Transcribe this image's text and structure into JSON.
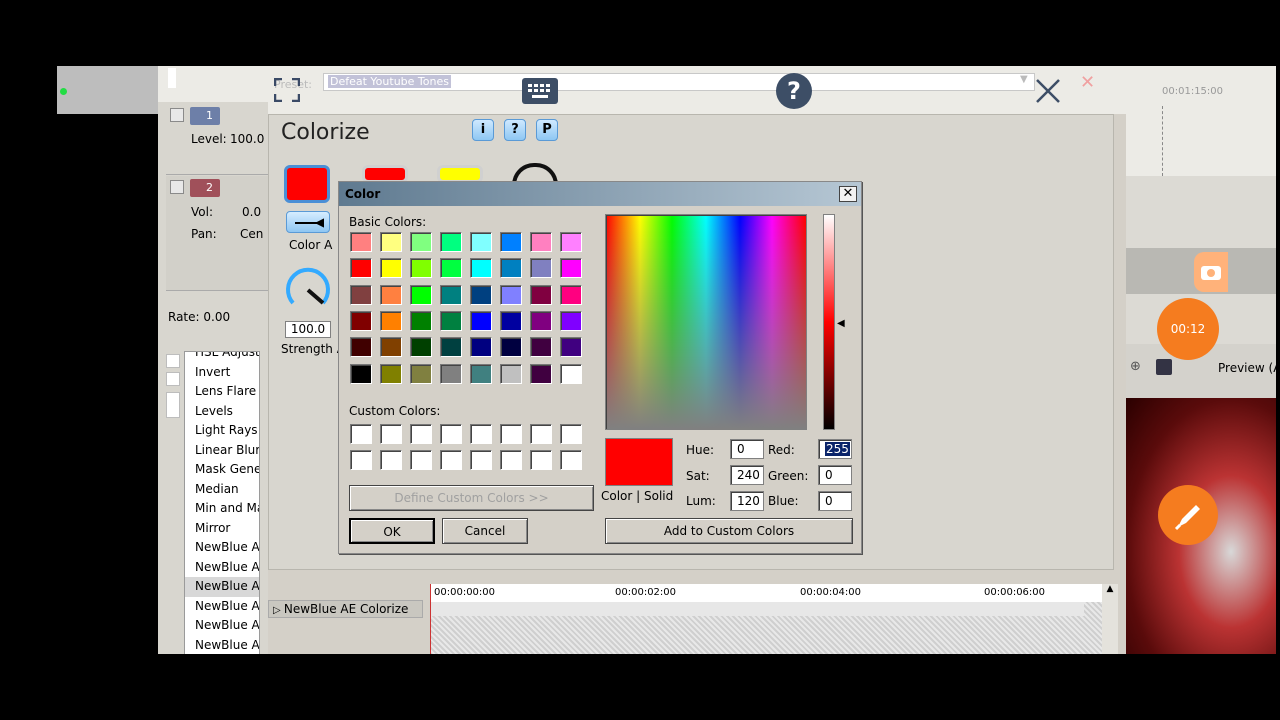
{
  "preset": {
    "label": "Preset:",
    "value": "Defeat Youtube Tones"
  },
  "tracks": [
    {
      "number": "1",
      "fields": [
        {
          "label": "Level:",
          "value": "100.0"
        }
      ]
    },
    {
      "number": "2",
      "fields": [
        {
          "label": "Vol:",
          "value": "0.0"
        },
        {
          "label": "Pan:",
          "value": "Cen"
        }
      ]
    }
  ],
  "rate_label": "Rate: 0.00",
  "fx_list": [
    "HSL Adjust",
    "Invert",
    "Lens Flare",
    "Levels",
    "Light Rays",
    "Linear Blur",
    "Mask Gener",
    "Median",
    "Min and Ma",
    "Mirror",
    "NewBlue AE",
    "NewBlue AE",
    "NewBlue AE",
    "NewBlue AE",
    "NewBlue AE",
    "NewBlue AE"
  ],
  "fx_selected_index": 12,
  "plugin": {
    "title": "Colorize",
    "tool_buttons": [
      "i",
      "?",
      "P"
    ],
    "color_a_label": "Color A",
    "strength_value": "100.0",
    "strength_label": "Strength A"
  },
  "timeline": {
    "track_name": "NewBlue AE Colorize",
    "ticks": [
      "00:00:00:00",
      "00:00:02:00",
      "00:00:04:00",
      "00:00:06:00"
    ],
    "top_ruler": "00:01:15:00"
  },
  "color_dialog": {
    "title": "Color",
    "basic_colors_label": "Basic Colors:",
    "custom_colors_label": "Custom Colors:",
    "basic_colors": [
      "#ff8080",
      "#ffff80",
      "#80ff80",
      "#00ff80",
      "#80ffff",
      "#0080ff",
      "#ff80c0",
      "#ff80ff",
      "#ff0000",
      "#ffff00",
      "#80ff00",
      "#00ff40",
      "#00ffff",
      "#0080c0",
      "#8080c0",
      "#ff00ff",
      "#804040",
      "#ff8040",
      "#00ff00",
      "#008080",
      "#004080",
      "#8080ff",
      "#800040",
      "#ff0080",
      "#800000",
      "#ff8000",
      "#008000",
      "#008040",
      "#0000ff",
      "#0000a0",
      "#800080",
      "#8000ff",
      "#400000",
      "#804000",
      "#004000",
      "#004040",
      "#000080",
      "#000040",
      "#400040",
      "#400080",
      "#000000",
      "#808000",
      "#808040",
      "#808080",
      "#408080",
      "#c0c0c0",
      "#400040",
      "#ffffff"
    ],
    "define_custom_label": "Define Custom Colors >>",
    "ok_label": "OK",
    "cancel_label": "Cancel",
    "color_solid_label": "Color | Solid",
    "add_custom_label": "Add to Custom Colors",
    "current_color": "#ff0000",
    "fields": {
      "hue": {
        "label": "Hue:",
        "value": "0"
      },
      "sat": {
        "label": "Sat:",
        "value": "240"
      },
      "lum": {
        "label": "Lum:",
        "value": "120"
      },
      "red": {
        "label": "Red:",
        "value": "255"
      },
      "green": {
        "label": "Green:",
        "value": "0"
      },
      "blue": {
        "label": "Blue:",
        "value": "0"
      }
    }
  },
  "overlay": {
    "timer": "00:12",
    "preview_label": "Preview (A"
  },
  "colors": {
    "accent_orange": "#f57c1f",
    "dialog_title": "#6b8499"
  }
}
